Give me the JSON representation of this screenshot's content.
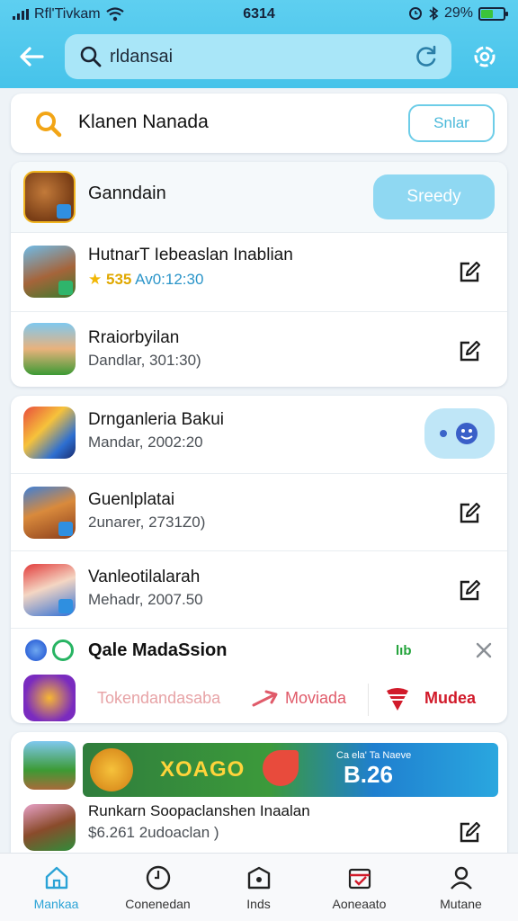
{
  "status_bar": {
    "carrier": "Rfl'Tivkam",
    "time": "6314",
    "battery": "29%",
    "battery_level": 0.29
  },
  "header": {
    "search_text": "rldansai",
    "icons": [
      "back-arrow-icon",
      "search-icon",
      "refresh-icon",
      "settings-icon"
    ]
  },
  "search_result": {
    "title": "Klanen Nanada",
    "button": "Snlar"
  },
  "group1": {
    "header": {
      "name": "Ganndain",
      "button": "Sreedy"
    },
    "rows": [
      {
        "title": "HutnarT Iebeaslan Inablian",
        "score": "535",
        "detail": "Av0:12:30"
      },
      {
        "title": "Rraiorbyilan",
        "detail": "Dandlar, 301:30)"
      }
    ]
  },
  "group2": {
    "rows": [
      {
        "title": "Drnganleria Bakui",
        "detail": "Mandar, 2002:20"
      },
      {
        "title": "Guenlplatai",
        "detail": "2unarer, 2731Z0)"
      },
      {
        "title": "Vanleotilalarah",
        "detail": "Mehadr, 2007.50"
      }
    ],
    "promo": {
      "title": "Qale MadaSsion",
      "badge": "lıb",
      "items": [
        "Tokendandasaba",
        "Moviada",
        "Mudea"
      ]
    }
  },
  "group3": {
    "banner": {
      "left": "XOAGO",
      "small": "Ca ela' Ta Naeve",
      "big": "B.26"
    },
    "row": {
      "title": "Runkarn Soopaclanshen Inaalan",
      "detail": "$6.261 2udoaclan )"
    }
  },
  "tabbar": [
    {
      "label": "Mankaa",
      "icon": "home-icon",
      "active": true
    },
    {
      "label": "Conenedan",
      "icon": "clock-icon",
      "active": false
    },
    {
      "label": "Inds",
      "icon": "bag-icon",
      "active": false
    },
    {
      "label": "Aoneaato",
      "icon": "calendar-icon",
      "active": false
    },
    {
      "label": "Mutane",
      "icon": "profile-icon",
      "active": false
    }
  ],
  "colors": {
    "header": "#46c3ea",
    "accent": "#2ba3d6",
    "promo_red": "#d11a2a",
    "badge_green": "#22a33a",
    "background": "#eef3f7"
  }
}
